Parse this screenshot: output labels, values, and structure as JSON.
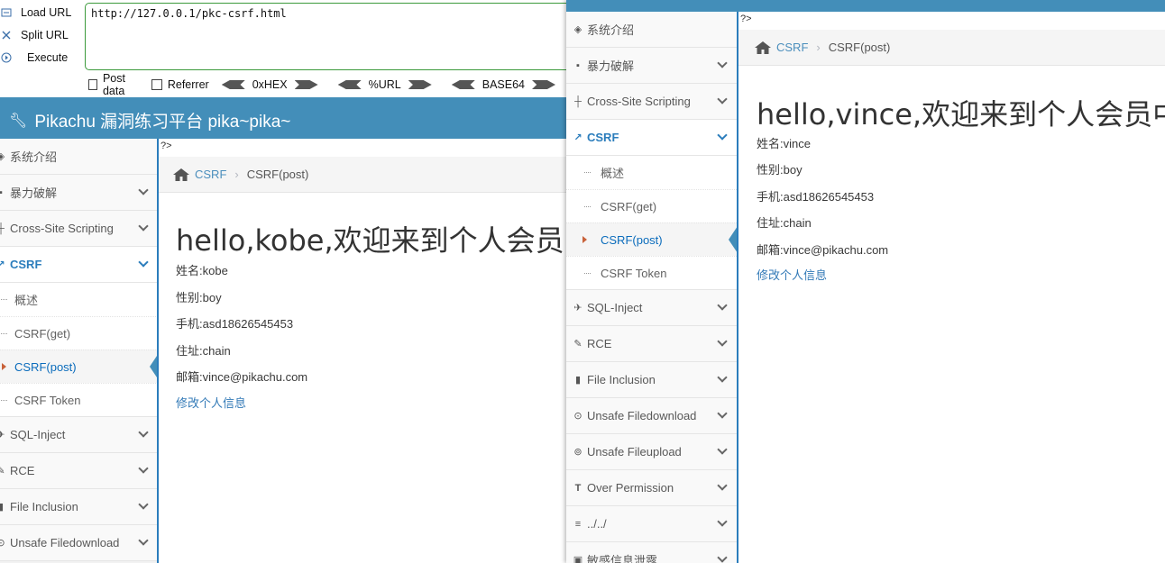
{
  "hackbar": {
    "actions": [
      {
        "label": "Load URL",
        "icon": "load-icon"
      },
      {
        "label": "Split URL",
        "icon": "split-icon"
      },
      {
        "label": "Execute",
        "icon": "execute-icon"
      }
    ],
    "url": "http://127.0.0.1/pkc-csrf.html",
    "checkboxes": [
      "Post data",
      "Referrer"
    ],
    "encoders": [
      "0xHEX",
      "%URL",
      "BASE64"
    ]
  },
  "brand": "Pikachu 漏洞练习平台 pika~pika~",
  "php_tag": "?>",
  "breadcrumb": {
    "parent": "CSRF",
    "current": "CSRF(post)"
  },
  "sidebar": {
    "items": [
      {
        "label": "系统介绍",
        "icon": "tags-icon",
        "chevron": false
      },
      {
        "label": "暴力破解",
        "icon": "lock-icon",
        "chevron": true
      },
      {
        "label": "Cross-Site Scripting",
        "icon": "sitemap-icon",
        "chevron": true
      },
      {
        "label": "CSRF",
        "icon": "share-icon",
        "chevron": true,
        "active": true
      },
      {
        "label": "SQL-Inject",
        "icon": "plane-icon",
        "chevron": true
      },
      {
        "label": "RCE",
        "icon": "pencil-icon",
        "chevron": true
      },
      {
        "label": "File Inclusion",
        "icon": "file-icon",
        "chevron": true
      },
      {
        "label": "Unsafe Filedownload",
        "icon": "download-icon",
        "chevron": true
      },
      {
        "label": "Unsafe Fileupload",
        "icon": "upload-icon",
        "chevron": true
      },
      {
        "label": "Over Permission",
        "icon": "text-height-icon",
        "chevron": true
      },
      {
        "label": "../../",
        "icon": "align-icon",
        "chevron": true
      },
      {
        "label": "敏感信息泄露",
        "icon": "camera-icon",
        "chevron": true
      }
    ],
    "csrf_submenu": [
      {
        "label": "概述"
      },
      {
        "label": "CSRF(get)"
      },
      {
        "label": "CSRF(post)",
        "active": true
      },
      {
        "label": "CSRF Token"
      }
    ]
  },
  "back_window": {
    "title": "hello,kobe,欢迎来到个人会员中心",
    "fields": [
      "姓名:kobe",
      "性别:boy",
      "手机:asd18626545453",
      "住址:chain",
      "邮箱:vince@pikachu.com"
    ],
    "edit_link": "修改个人信息"
  },
  "front_window": {
    "title": "hello,vince,欢迎来到个人会员中心",
    "fields": [
      "姓名:vince",
      "性别:boy",
      "手机:asd18626545453",
      "住址:chain",
      "邮箱:vince@pikachu.com"
    ],
    "edit_link": "修改个人信息"
  },
  "colors": {
    "navbar": "#438eb9",
    "link": "#337ab7",
    "active_nav": "#2b7dbc",
    "hackbar_border": "#3c9a3c"
  }
}
